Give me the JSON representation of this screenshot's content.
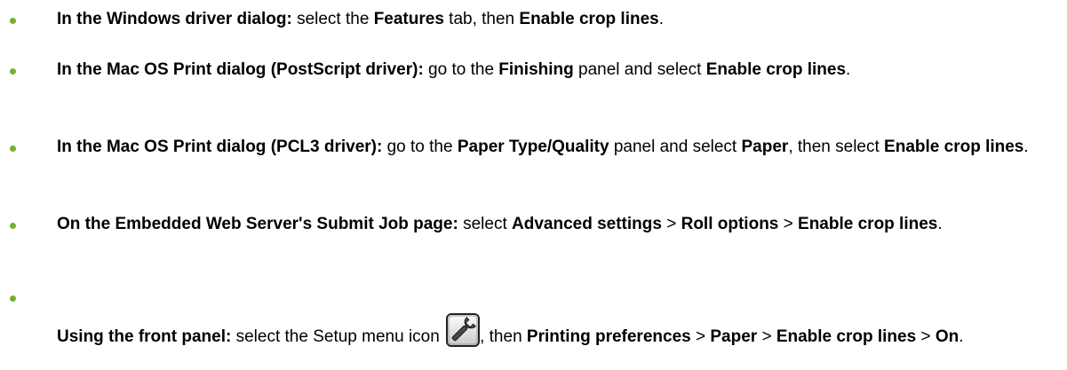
{
  "items": [
    {
      "lead": "In the Windows driver dialog:",
      "t1": " select the ",
      "b1": "Features",
      "t2": " tab, then ",
      "b2": "Enable crop lines",
      "t3": "."
    },
    {
      "lead": "In the Mac OS Print dialog (PostScript driver):",
      "t1": " go to the ",
      "b1": "Finishing",
      "t2": " panel and select ",
      "b2": "Enable crop lines",
      "t3": "."
    },
    {
      "lead": "In the Mac OS Print dialog (PCL3 driver):",
      "t1": " go to the ",
      "b1": "Paper Type/Quality",
      "t2": " panel and select ",
      "b2": "Paper",
      "t3": ", then select ",
      "b3": "Enable crop lines",
      "t4": "."
    },
    {
      "lead": "On the Embedded Web Server's Submit Job page:",
      "t1": " select ",
      "b1": "Advanced settings",
      "t2": " > ",
      "b2": "Roll options",
      "t3": " > ",
      "b3": "Enable crop lines",
      "t4": "."
    },
    {
      "lead": "Using the front panel:",
      "t1": " select the Setup menu icon ",
      "icon": "setup-wrench-icon",
      "t2": ", then ",
      "b1": "Printing preferences",
      "t3": " > ",
      "b2": "Paper",
      "t4": " > ",
      "b3": "Enable crop lines",
      "t5": " > ",
      "b4": "On",
      "t6": "."
    }
  ],
  "colors": {
    "bullet": "#6fb52c",
    "text": "#000000"
  }
}
